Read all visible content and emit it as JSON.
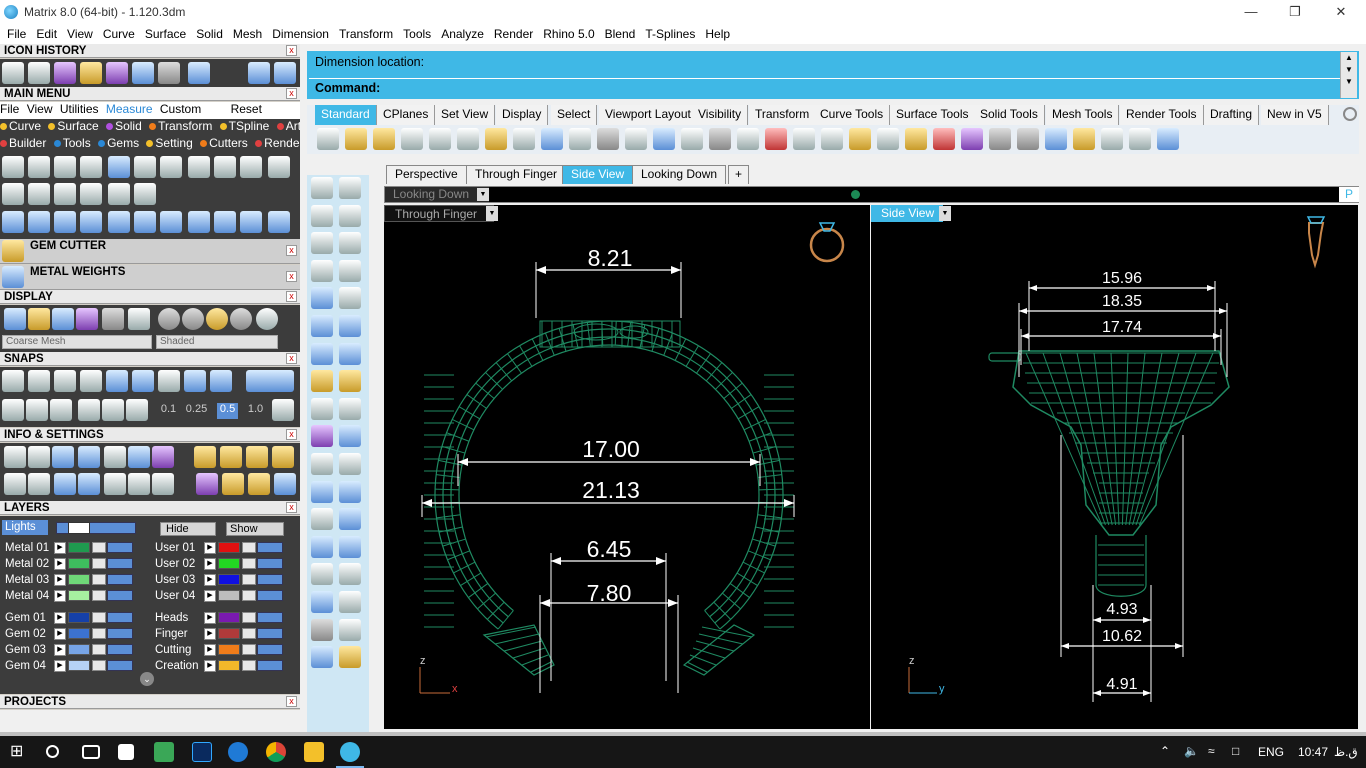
{
  "window": {
    "title": "Matrix 8.0 (64-bit) - 1.120.3dm"
  },
  "menu": [
    "File",
    "Edit",
    "View",
    "Curve",
    "Surface",
    "Solid",
    "Mesh",
    "Dimension",
    "Transform",
    "Tools",
    "Analyze",
    "Render",
    "Rhino 5.0",
    "Blend",
    "T-Splines",
    "Help"
  ],
  "left": {
    "icon_history": "ICON HISTORY",
    "main_menu": "MAIN MENU",
    "mm_row1": [
      "File",
      "View",
      "Utilities",
      "Measure",
      "Custom",
      "Reset"
    ],
    "mm_row2": [
      "Curve",
      "Surface",
      "Solid",
      "Transform",
      "TSpline",
      "Art"
    ],
    "mm_row3": [
      "Builder",
      "Tools",
      "Gems",
      "Setting",
      "Cutters",
      "Render"
    ],
    "gem_cutter": "GEM CUTTER",
    "metal_weights": "METAL WEIGHTS",
    "display": "DISPLAY",
    "display_mesh": "Coarse Mesh",
    "display_mode": "Shaded",
    "snaps": "SNAPS",
    "snap_values": [
      "0.1",
      "0.25",
      "0.5",
      "1.0"
    ],
    "info_settings": "INFO & SETTINGS",
    "layers": "LAYERS",
    "lights": "Lights",
    "hide": "Hide",
    "show": "Show",
    "layers_left": [
      {
        "name": "Metal 01",
        "color": "#1f9a4f"
      },
      {
        "name": "Metal 02",
        "color": "#3ebd5e"
      },
      {
        "name": "Metal 03",
        "color": "#6fd878"
      },
      {
        "name": "Metal 04",
        "color": "#a6f0a0"
      },
      {
        "name": "Gem 01",
        "color": "#1540a8"
      },
      {
        "name": "Gem 02",
        "color": "#3c72cf"
      },
      {
        "name": "Gem 03",
        "color": "#77a4e6"
      },
      {
        "name": "Gem 04",
        "color": "#b6d2f5"
      }
    ],
    "layers_right": [
      {
        "name": "User 01",
        "color": "#e01010"
      },
      {
        "name": "User 02",
        "color": "#22d822"
      },
      {
        "name": "User 03",
        "color": "#1010e0"
      },
      {
        "name": "User 04",
        "color": "#bdbdbd"
      },
      {
        "name": "Heads",
        "color": "#7a1ab0"
      },
      {
        "name": "Finger",
        "color": "#b03a3a"
      },
      {
        "name": "Cutting",
        "color": "#f07c1a"
      },
      {
        "name": "Creation",
        "color": "#f3b82a"
      }
    ],
    "projects": "PROJECTS"
  },
  "command": {
    "line1": "Dimension location:",
    "line2": "Command:"
  },
  "toolbar_tabs": [
    "Standard",
    "CPlanes",
    "Set View",
    "Display",
    "Select",
    "Viewport Layout",
    "Visibility",
    "Transform",
    "Curve Tools",
    "Surface Tools",
    "Solid Tools",
    "Mesh Tools",
    "Render Tools",
    "Drafting",
    "New in V5"
  ],
  "viewport_tabs": [
    "Perspective",
    "Through Finger",
    "Side View",
    "Looking Down"
  ],
  "viewports": {
    "top_label": "Looking Down",
    "left_label": "Through Finger",
    "right_label": "Side View",
    "top_right_tag": "P"
  },
  "dimensions_left": [
    "8.21",
    "17.00",
    "21.13",
    "6.45",
    "7.80"
  ],
  "dimensions_right": [
    "15.96",
    "18.35",
    "17.74",
    "4.93",
    "10.62",
    "4.91"
  ],
  "axes": {
    "left": [
      "z",
      "x"
    ],
    "right": [
      "z",
      "y"
    ]
  },
  "taskbar": {
    "lang": "ENG",
    "time": "10:47",
    "suffix": "ق.ظ"
  }
}
